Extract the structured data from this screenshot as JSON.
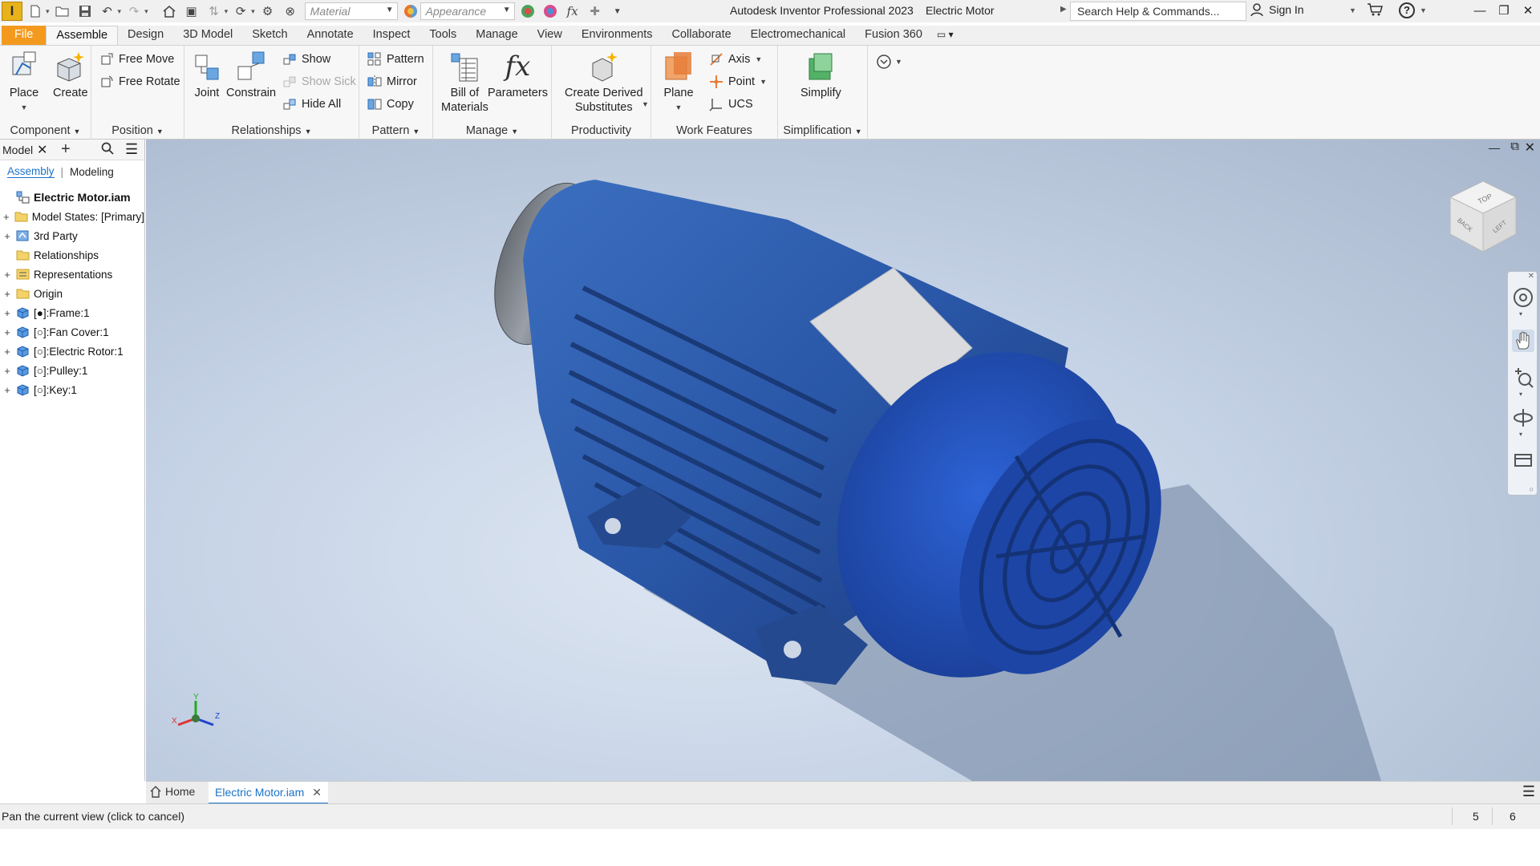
{
  "app": {
    "logo_letter": "I",
    "title": "Autodesk Inventor Professional 2023",
    "document": "Electric Motor"
  },
  "quick_access": {
    "material_placeholder": "Material",
    "appearance_placeholder": "Appearance",
    "search_help": "Search Help & Commands...",
    "sign_in": "Sign In"
  },
  "ribbon_tabs": [
    "File",
    "Assemble",
    "Design",
    "3D Model",
    "Sketch",
    "Annotate",
    "Inspect",
    "Tools",
    "Manage",
    "View",
    "Environments",
    "Collaborate",
    "Electromechanical",
    "Fusion 360"
  ],
  "ribbon": {
    "component": {
      "label": "Component",
      "place": "Place",
      "create": "Create"
    },
    "position": {
      "label": "Position",
      "free_move": "Free Move",
      "free_rotate": "Free Rotate"
    },
    "relationships": {
      "label": "Relationships",
      "joint": "Joint",
      "constrain": "Constrain",
      "show": "Show",
      "show_sick": "Show Sick",
      "hide_all": "Hide All"
    },
    "pattern": {
      "label": "Pattern",
      "pattern": "Pattern",
      "mirror": "Mirror",
      "copy": "Copy"
    },
    "manage": {
      "label": "Manage",
      "bom_line1": "Bill of",
      "bom_line2": "Materials",
      "parameters": "Parameters"
    },
    "productivity": {
      "label": "Productivity",
      "create_derived_line1": "Create Derived",
      "create_derived_line2": "Substitutes"
    },
    "work_features": {
      "label": "Work Features",
      "plane": "Plane",
      "axis": "Axis",
      "point": "Point",
      "ucs": "UCS"
    },
    "simplification": {
      "label": "Simplification",
      "simplify": "Simplify"
    }
  },
  "browser": {
    "title": "Model",
    "subtabs": {
      "assembly": "Assembly",
      "modeling": "Modeling"
    },
    "tree": [
      {
        "label": "Electric Motor.iam",
        "root": true,
        "icon": "assembly-icon",
        "expandable": false
      },
      {
        "label": "Model States: [Primary]",
        "icon": "folder-icon",
        "expandable": true
      },
      {
        "label": "3rd Party",
        "icon": "third-party-icon",
        "expandable": true
      },
      {
        "label": "Relationships",
        "icon": "folder-icon",
        "expandable": false
      },
      {
        "label": "Representations",
        "icon": "representations-icon",
        "expandable": true
      },
      {
        "label": "Origin",
        "icon": "folder-icon",
        "expandable": true
      },
      {
        "label": "[●]:Frame:1",
        "icon": "part-icon",
        "expandable": true
      },
      {
        "label": "[○]:Fan Cover:1",
        "icon": "part-icon",
        "expandable": true
      },
      {
        "label": "[○]:Electric Rotor:1",
        "icon": "part-icon",
        "expandable": true
      },
      {
        "label": "[○]:Pulley:1",
        "icon": "part-icon",
        "expandable": true
      },
      {
        "label": "[○]:Key:1",
        "icon": "part-icon",
        "expandable": true
      }
    ]
  },
  "viewcube": {
    "top": "TOP",
    "back": "BACK",
    "left": "LEFT"
  },
  "triad": {
    "x": "X",
    "y": "Y",
    "z": "Z"
  },
  "doc_tabs": {
    "home": "Home",
    "active": "Electric Motor.iam"
  },
  "status": {
    "message": "Pan the current view (click to cancel)",
    "num1": "5",
    "num2": "6"
  },
  "colors": {
    "file_tab": "#f39a1e",
    "accent_blue": "#1a73c8",
    "motor_blue": "#2a57a8",
    "fan_cover_blue": "#1f4fb8"
  }
}
